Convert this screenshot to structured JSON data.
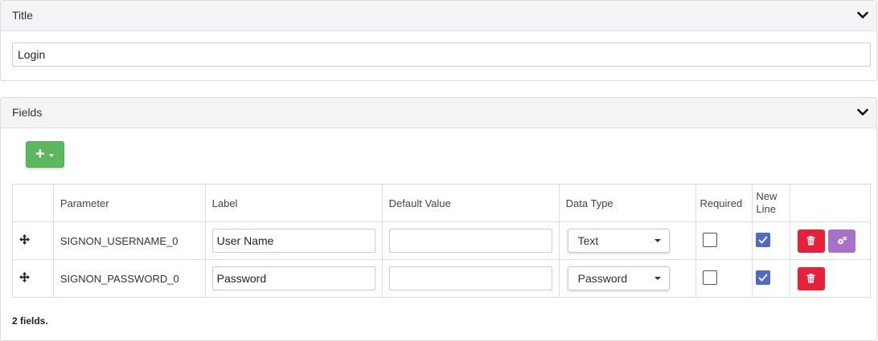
{
  "title_panel": {
    "header": "Title",
    "input_value": "Login"
  },
  "fields_panel": {
    "header": "Fields",
    "add_button_label": "+",
    "columns": {
      "parameter": "Parameter",
      "label": "Label",
      "default_value": "Default Value",
      "data_type": "Data Type",
      "required": "Required",
      "new_line": "New Line"
    },
    "rows": [
      {
        "parameter": "SIGNON_USERNAME_0",
        "label": "User Name",
        "default_value": "",
        "data_type": "Text",
        "required": false,
        "new_line": true,
        "actions": [
          "delete",
          "settings"
        ]
      },
      {
        "parameter": "SIGNON_PASSWORD_0",
        "label": "Password",
        "default_value": "",
        "data_type": "Password",
        "required": false,
        "new_line": true,
        "actions": [
          "delete"
        ]
      }
    ],
    "count_text": "2 fields."
  },
  "icons": {
    "collapse": "chevron-down-icon",
    "move": "move-icon",
    "delete": "trash-icon",
    "settings": "gears-icon",
    "check": "check-icon"
  },
  "colors": {
    "add_button": "#5cb85c",
    "delete_button": "#e8213b",
    "settings_button": "#a872c9",
    "checkbox_checked": "#5169c2",
    "header_bg": "#f4f4f6"
  }
}
